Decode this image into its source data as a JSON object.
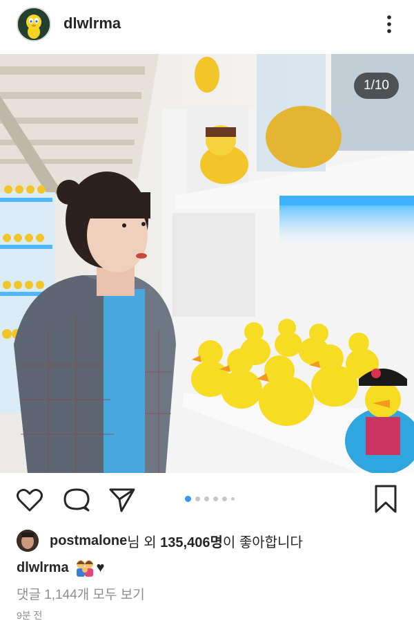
{
  "header": {
    "username": "dlwlrma",
    "avatar_icon": "tweety-avatar-icon",
    "more_icon": "more-vertical-icon"
  },
  "post": {
    "page_counter": "1/10",
    "carousel": {
      "total_dots": 6,
      "active_index": 0
    }
  },
  "actions": {
    "like_icon": "heart-icon",
    "comment_icon": "comment-icon",
    "share_icon": "send-icon",
    "save_icon": "bookmark-icon"
  },
  "likes": {
    "liker": "postmalone",
    "middle": "님 외 ",
    "count": "135,406명",
    "suffix": "이 좋아합니다"
  },
  "caption": {
    "username": "dlwlrma",
    "emoji_icon": "family-emoji-icon",
    "heart": "♥"
  },
  "comments_link": "댓글 1,144개 모두 보기",
  "timestamp": "9분 전",
  "colors": {
    "accent": "#3897f0",
    "muted": "#8e8e8e",
    "text": "#262626"
  }
}
